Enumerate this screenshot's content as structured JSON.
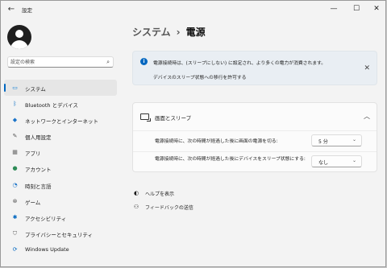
{
  "app": {
    "title": "設定"
  },
  "search": {
    "placeholder": "設定の検索"
  },
  "sidebar": {
    "items": [
      {
        "label": "システム",
        "icon": "monitor-icon",
        "glyph": "▭",
        "color": "#0078d4",
        "selected": true
      },
      {
        "label": "Bluetooth とデバイス",
        "icon": "bluetooth-icon",
        "glyph": "ᛒ",
        "color": "#0067c0"
      },
      {
        "label": "ネットワークとインターネット",
        "icon": "wifi-icon",
        "glyph": "◆",
        "color": "#1a73c8"
      },
      {
        "label": "個人用設定",
        "icon": "brush-icon",
        "glyph": "✎",
        "color": "#555555"
      },
      {
        "label": "アプリ",
        "icon": "apps-icon",
        "glyph": "▦",
        "color": "#666666"
      },
      {
        "label": "アカウント",
        "icon": "account-icon",
        "glyph": "●",
        "color": "#2e8b57"
      },
      {
        "label": "時刻と言語",
        "icon": "clock-globe-icon",
        "glyph": "◔",
        "color": "#1a73c8"
      },
      {
        "label": "ゲーム",
        "icon": "gamepad-icon",
        "glyph": "⊗",
        "color": "#555555"
      },
      {
        "label": "アクセシビリティ",
        "icon": "accessibility-icon",
        "glyph": "✱",
        "color": "#0067c0"
      },
      {
        "label": "プライバシーとセキュリティ",
        "icon": "shield-icon",
        "glyph": "⛉",
        "color": "#666666"
      },
      {
        "label": "Windows Update",
        "icon": "update-icon",
        "glyph": "⟳",
        "color": "#0067c0"
      }
    ]
  },
  "main": {
    "breadcrumb": {
      "parent": "システム",
      "separator": "›",
      "current": "電源"
    },
    "banner": {
      "message": "電源接続時は、(スリープにしない) に設定され、より多くの電力が消費されます。",
      "link": "デバイスのスリープ状態への移行を許可する"
    },
    "screen_sleep": {
      "title": "画面とスリープ",
      "rows": [
        {
          "label": "電源接続時に、次の時間が経過した後に画面の電源を切る:",
          "value": "5 分"
        },
        {
          "label": "電源接続時に、次の時間が経過した後にデバイスをスリープ状態にする:",
          "value": "なし"
        }
      ]
    },
    "help": {
      "get_help": "ヘルプを表示",
      "feedback": "フィードバックの送信"
    }
  },
  "colors": {
    "accent": "#0067c0",
    "window_bg": "#f3f3f3",
    "banner_bg": "#e9eef3"
  }
}
